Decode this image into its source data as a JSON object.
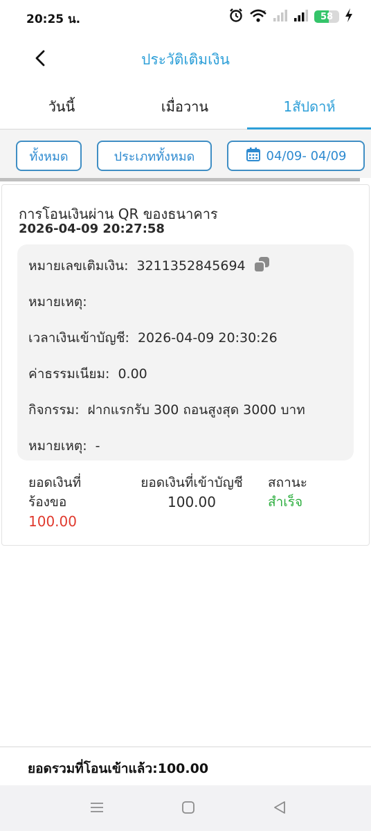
{
  "status_bar": {
    "time": "20:25 น.",
    "battery": "58",
    "battery_level": 0.58,
    "icons": [
      "alarm-icon",
      "wifi-icon",
      "signal-icon",
      "signal-icon",
      "battery-icon",
      "charging-icon"
    ]
  },
  "header": {
    "title": "ประวัติเติมเงิน",
    "back_icon": "chevron-left-icon"
  },
  "tabs": [
    {
      "label": "วันนี้",
      "active": false
    },
    {
      "label": "เมื่อวาน",
      "active": false
    },
    {
      "label": "1สัปดาห์",
      "active": true
    }
  ],
  "filters": {
    "all": "ทั้งหมด",
    "all_types": "ประเภททั้งหมด",
    "date_range": "04/09- 04/09",
    "calendar_icon": "calendar-icon"
  },
  "record": {
    "title": "การโอนเงินผ่าน QR ของธนาคาร",
    "datetime": "2026-04-09 20:27:58",
    "details": {
      "topup_no_label": "หมายเลขเติมเงิน:",
      "topup_no_value": "3211352845694",
      "note_label": "หมายเหตุ:",
      "credit_time_label": "เวลาเงินเข้าบัญชี:",
      "credit_time_value": "2026-04-09 20:30:26",
      "fee_label": "ค่าธรรมเนียม:",
      "fee_value": "0.00",
      "activity_label": "กิจกรรม:",
      "activity_value": "ฝากแรกรับ 300 ถอนสูงสุด 3000 บาท",
      "note2_label": "หมายเหตุ:",
      "note2_value": "-"
    },
    "summary": {
      "requested_label_1": "ยอดเงินที่",
      "requested_label_2": "ร้องขอ",
      "requested_value": "100.00",
      "credited_label": "ยอดเงินที่เข้าบัญชี",
      "credited_value": "100.00",
      "status_label": "สถานะ",
      "status_value": "สำเร็จ"
    }
  },
  "footer": {
    "total": "ยอดรวมที่โอนเข้าแล้ว:100.00"
  },
  "colors": {
    "accent": "#2d9fd8",
    "requested": "#e03a2e",
    "success": "#2dae3f"
  }
}
